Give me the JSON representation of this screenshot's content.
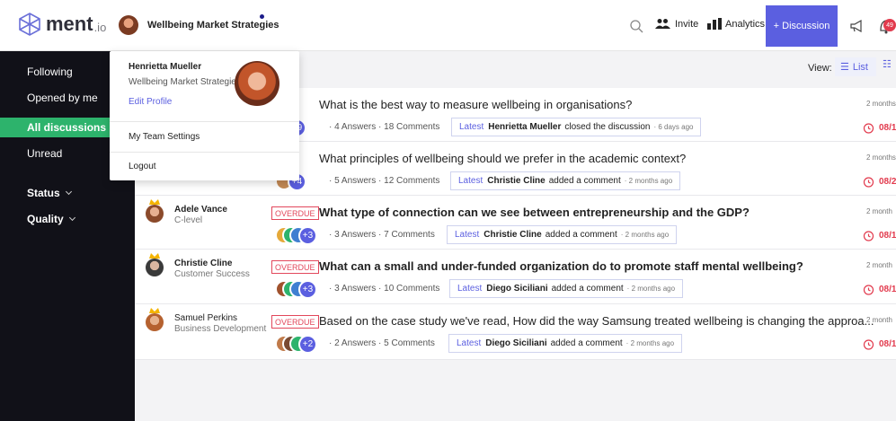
{
  "header": {
    "logo_text": "ment",
    "logo_suffix": ".io",
    "org_name": "Wellbeing Market Strategies",
    "invite_label": "Invite",
    "analytics_label": "Analytics",
    "discussion_label": "+ Discussion",
    "notification_count": "49"
  },
  "sidebar": {
    "items": [
      {
        "label": "Following"
      },
      {
        "label": "Opened by me"
      },
      {
        "label": "All discussions"
      },
      {
        "label": "Unread"
      }
    ],
    "status_label": "Status",
    "quality_label": "Quality"
  },
  "toolbar": {
    "view_label": "View:",
    "list_label": "List",
    "grid_label": "G"
  },
  "dropdown": {
    "name": "Henrietta Mueller",
    "org": "Wellbeing Market Strategies",
    "edit_profile": "Edit Profile",
    "team_settings": "My Team Settings",
    "logout": "Logout"
  },
  "discussions": [
    {
      "author": "",
      "role": "",
      "badge": "UE",
      "title": "What is the best way to measure wellbeing in organisations?",
      "extra": "+9",
      "answers": "4 Answers",
      "comments": "18 Comments",
      "latest_label": "Latest",
      "latest_who": "Henrietta Mueller",
      "latest_what": "closed the discussion",
      "latest_when": "6 days ago",
      "ago": "2 months",
      "due": "08/1"
    },
    {
      "author": "",
      "role": "",
      "badge": "UE",
      "title": "What principles of wellbeing should we prefer in the academic context?",
      "extra": "+4",
      "answers": "5 Answers",
      "comments": "12 Comments",
      "latest_label": "Latest",
      "latest_who": "Christie Cline",
      "latest_what": "added a comment",
      "latest_when": "2 months ago",
      "ago": "2 months",
      "due": "08/2"
    },
    {
      "author": "Adele Vance",
      "role": "C-level",
      "badge": "OVERDUE",
      "title": "What type of connection can we see between entrepreneurship and the GDP?",
      "extra": "+3",
      "answers": "3 Answers",
      "comments": "7 Comments",
      "latest_label": "Latest",
      "latest_who": "Christie Cline",
      "latest_what": "added a comment",
      "latest_when": "2 months ago",
      "ago": "2 month",
      "due": "08/1"
    },
    {
      "author": "Christie Cline",
      "role": "Customer Success",
      "badge": "OVERDUE",
      "title": "What can a small and under-funded organization do to promote staff mental wellbeing?",
      "extra": "+3",
      "answers": "3 Answers",
      "comments": "10 Comments",
      "latest_label": "Latest",
      "latest_who": "Diego Siciliani",
      "latest_what": "added a comment",
      "latest_when": "2 months ago",
      "ago": "2 month",
      "due": "08/1"
    },
    {
      "author": "Samuel Perkins",
      "role": "Business Development",
      "badge": "OVERDUE",
      "title": "Based on the case study we've read, How did the way Samsung treated wellbeing is changing the approa...",
      "extra": "+2",
      "answers": "2 Answers",
      "comments": "5 Comments",
      "latest_label": "Latest",
      "latest_who": "Diego Siciliani",
      "latest_what": "added a comment",
      "latest_when": "2 months ago",
      "ago": "2 month",
      "due": "08/1"
    }
  ],
  "colors": {
    "accent": "#5b5fe0",
    "sidebar_bg": "#111118",
    "active_green": "#2db36c",
    "overdue_red": "#e2475b"
  }
}
